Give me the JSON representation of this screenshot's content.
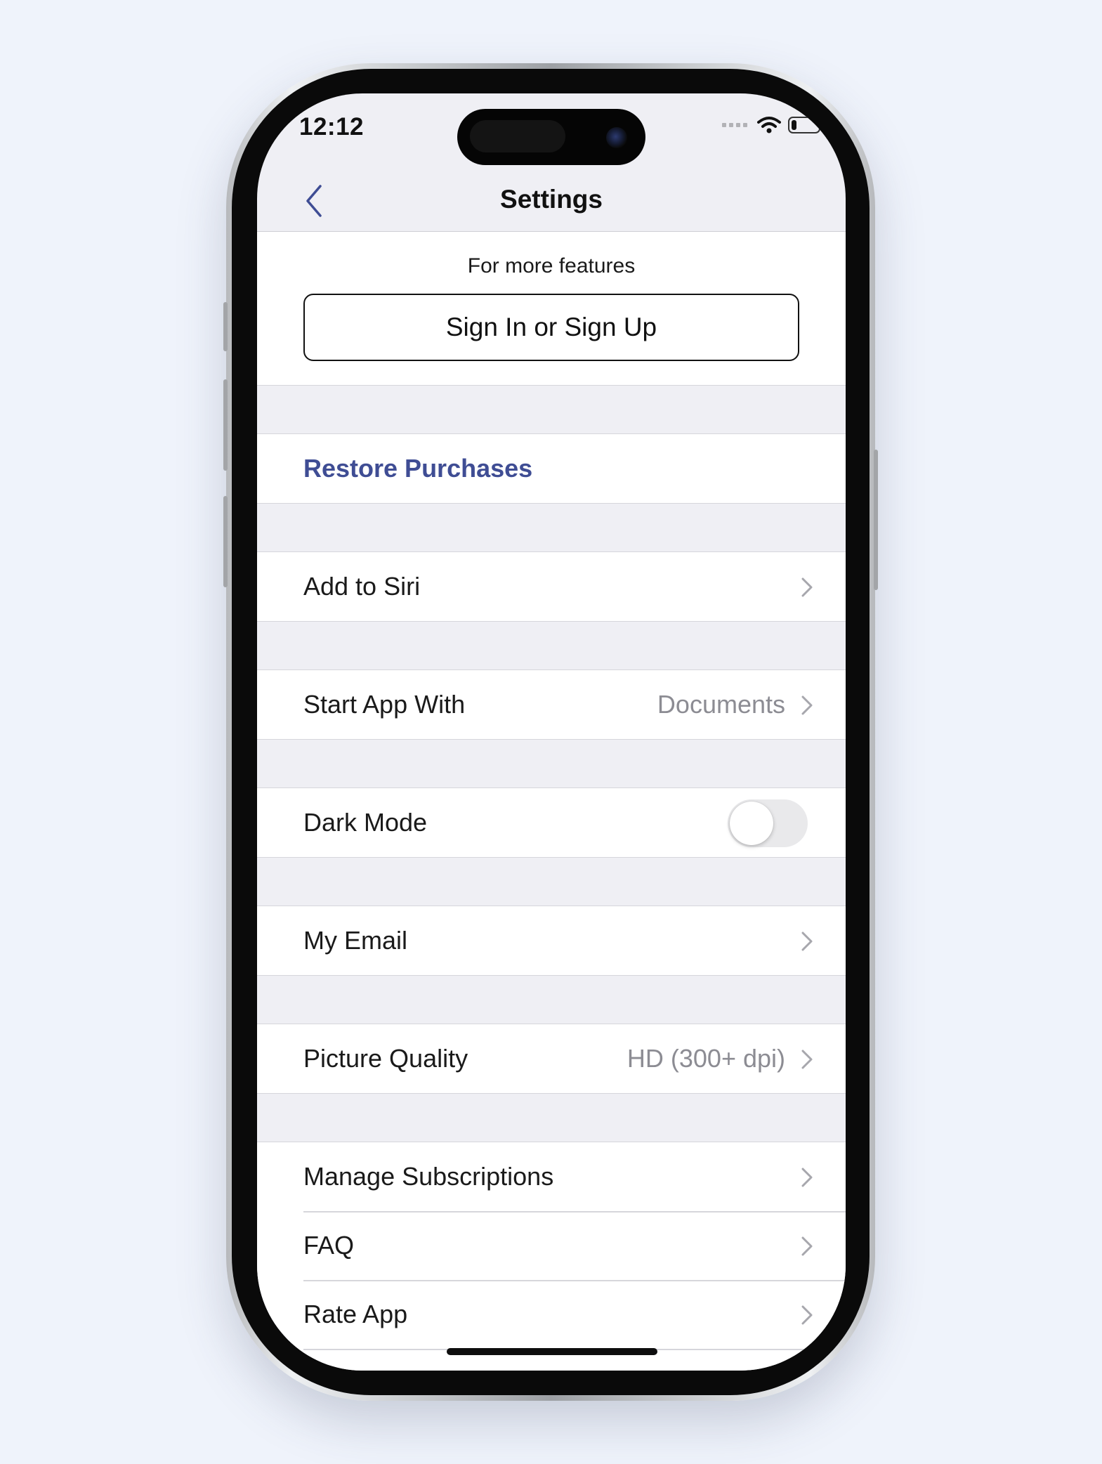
{
  "status_bar": {
    "time": "12:12",
    "battery_level": 0.2
  },
  "nav": {
    "title": "Settings",
    "back_icon": "chevron-left-icon"
  },
  "account": {
    "caption": "For more features",
    "signin_label": "Sign In or Sign Up"
  },
  "rows": {
    "restore": {
      "label": "Restore Purchases"
    },
    "siri": {
      "label": "Add to Siri"
    },
    "start_app": {
      "label": "Start App With",
      "value": "Documents"
    },
    "dark_mode": {
      "label": "Dark Mode",
      "enabled": false
    },
    "email": {
      "label": "My Email"
    },
    "picture_quality": {
      "label": "Picture Quality",
      "value": "HD (300+ dpi)"
    },
    "subscriptions": {
      "label": "Manage Subscriptions"
    },
    "faq": {
      "label": "FAQ"
    },
    "rate": {
      "label": "Rate App"
    }
  },
  "colors": {
    "accent": "#3f4d94",
    "background": "#efeff4",
    "secondary_text": "#8c8c93",
    "page_background": "#eff3fb"
  }
}
